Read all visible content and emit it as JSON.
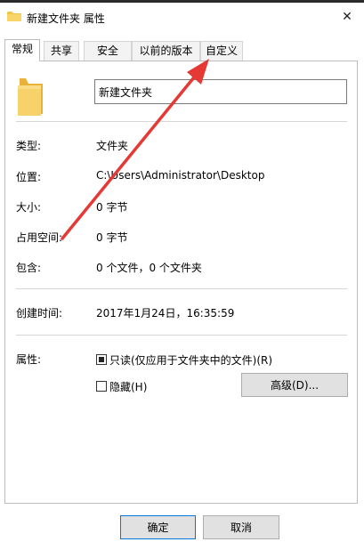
{
  "window": {
    "title": "新建文件夹 属性",
    "close_glyph": "✕"
  },
  "tabs": [
    {
      "label": "常规",
      "active": true
    },
    {
      "label": "共享",
      "active": false
    },
    {
      "label": "安全",
      "active": false
    },
    {
      "label": "以前的版本",
      "active": false
    },
    {
      "label": "自定义",
      "active": false
    }
  ],
  "general": {
    "folder_name": "新建文件夹",
    "type_label": "类型:",
    "type_value": "文件夹",
    "location_label": "位置:",
    "location_value": "C:\\Users\\Administrator\\Desktop",
    "size_label": "大小:",
    "size_value": "0 字节",
    "disk_size_label": "占用空间:",
    "disk_size_value": "0 字节",
    "contains_label": "包含:",
    "contains_value": "0 个文件，0 个文件夹",
    "created_label": "创建时间:",
    "created_value": "2017年1月24日，16:35:59",
    "attributes_label": "属性:",
    "readonly_label": "只读(仅应用于文件夹中的文件)(R)",
    "readonly_checked": true,
    "hidden_label": "隐藏(H)",
    "hidden_checked": false,
    "advanced_button": "高级(D)..."
  },
  "footer": {
    "ok_button": "确定",
    "cancel_button": "取消"
  },
  "colors": {
    "folder": "#f4c542",
    "annotation_arrow": "#e53935"
  }
}
